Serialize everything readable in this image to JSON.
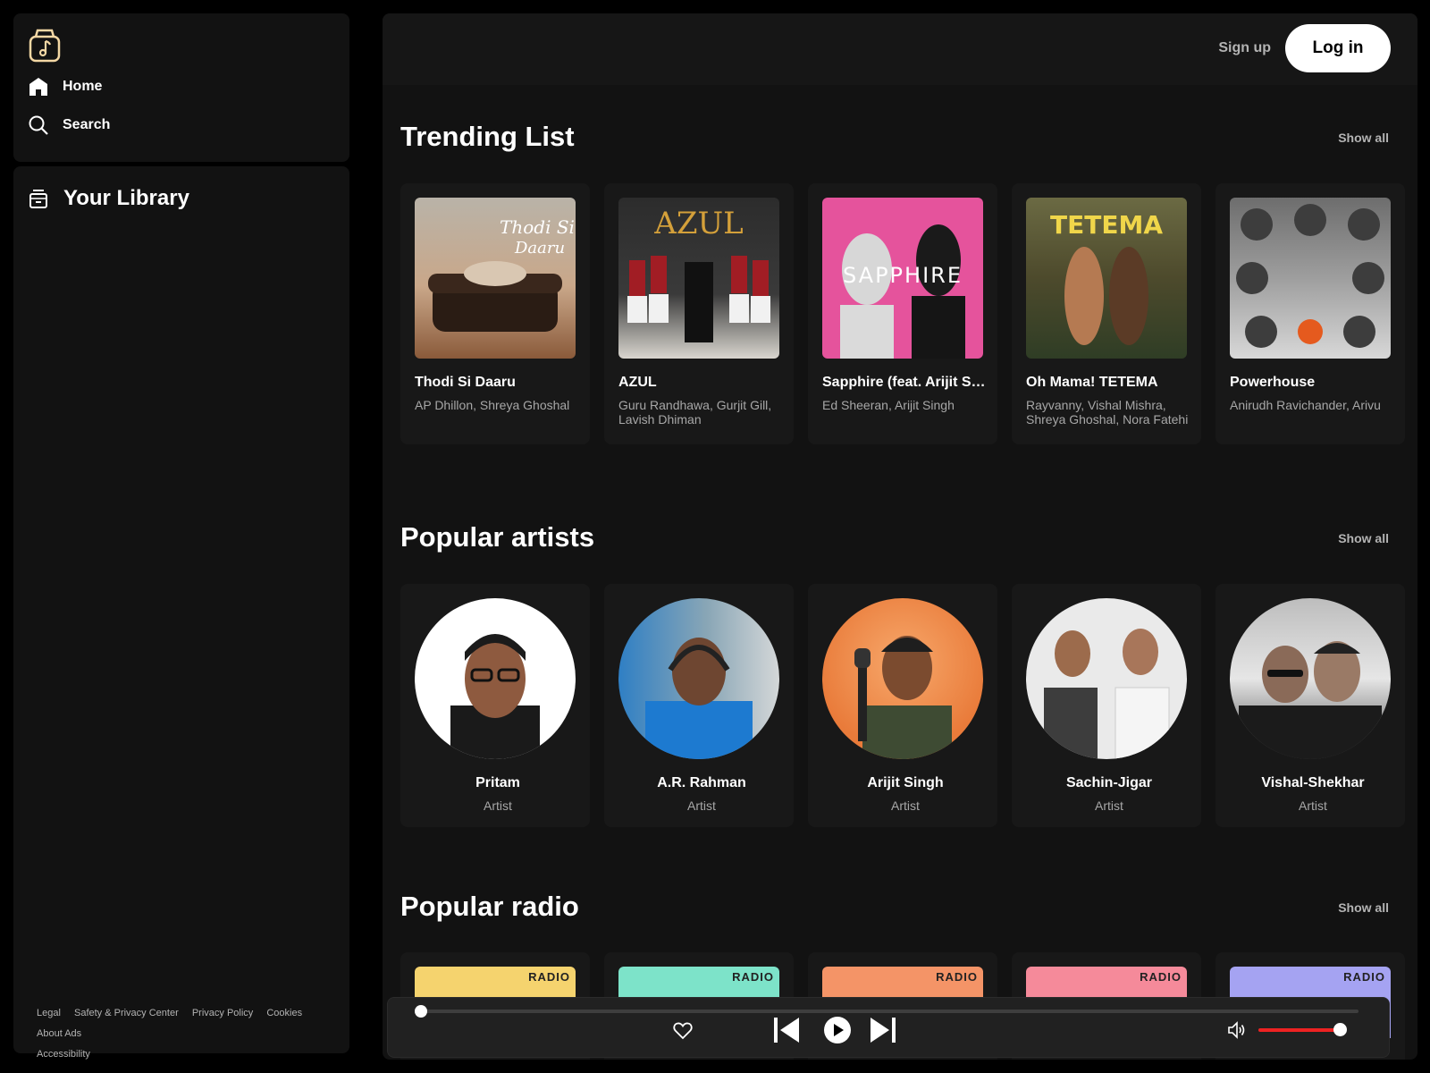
{
  "nav": {
    "home": "Home",
    "search": "Search",
    "library": "Your Library"
  },
  "footer": {
    "links": [
      "Legal",
      "Safety & Privacy Center",
      "Privacy Policy",
      "Cookies",
      "About Ads",
      "Accessibility"
    ]
  },
  "header": {
    "signup": "Sign up",
    "login": "Log in"
  },
  "sections": {
    "trending": {
      "title": "Trending List",
      "show_all": "Show all",
      "items": [
        {
          "title": "Thodi Si Daaru",
          "subtitle": "AP Dhillon, Shreya Ghoshal"
        },
        {
          "title": "AZUL",
          "subtitle": "Guru Randhawa, Gurjit Gill, Lavish Dhiman"
        },
        {
          "title": "Sapphire (feat. Arijit Singh)",
          "subtitle": "Ed Sheeran, Arijit Singh"
        },
        {
          "title": "Oh Mama! TETEMA",
          "subtitle": "Rayvanny, Vishal Mishra, Shreya Ghoshal, Nora Fatehi"
        },
        {
          "title": "Powerhouse",
          "subtitle": "Anirudh Ravichander, Arivu"
        }
      ]
    },
    "artists": {
      "title": "Popular artists",
      "show_all": "Show all",
      "items": [
        {
          "title": "Pritam",
          "subtitle": "Artist"
        },
        {
          "title": "A.R. Rahman",
          "subtitle": "Artist"
        },
        {
          "title": "Arijit Singh",
          "subtitle": "Artist"
        },
        {
          "title": "Sachin-Jigar",
          "subtitle": "Artist"
        },
        {
          "title": "Vishal-Shekhar",
          "subtitle": "Artist"
        }
      ]
    },
    "radio": {
      "title": "Popular radio",
      "show_all": "Show all",
      "items": [
        {
          "label": "RADIO",
          "color": "#f5d36e"
        },
        {
          "label": "RADIO",
          "color": "#7de3c9"
        },
        {
          "label": "RADIO",
          "color": "#f49467"
        },
        {
          "label": "RADIO",
          "color": "#f58a9a"
        },
        {
          "label": "RADIO",
          "color": "#a5a3f2"
        }
      ]
    }
  },
  "player": {
    "progress": 0.0,
    "volume": 1.0,
    "accent": "#e22222"
  },
  "icons": {
    "logo": "music-bag-icon",
    "home": "home-icon",
    "search": "search-icon",
    "library": "library-icon",
    "heart": "heart-icon",
    "prev": "skip-previous-icon",
    "play": "play-icon",
    "next": "skip-next-icon",
    "volume": "volume-icon"
  }
}
